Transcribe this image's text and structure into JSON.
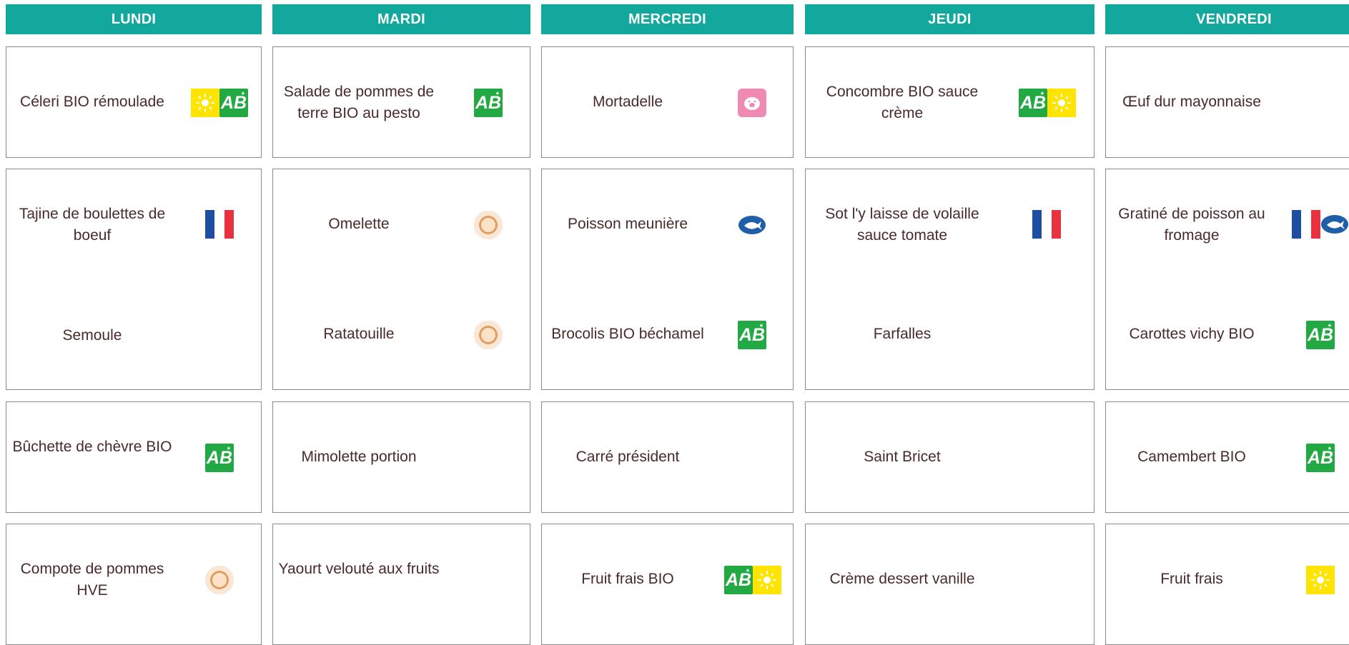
{
  "days": [
    {
      "name": "LUNDI",
      "entree": "Céleri BIO rémoulade",
      "plat": "Tajine de boulettes de boeuf",
      "accomp": "Semoule",
      "fromage": "Bûchette de chèvre BIO",
      "dessert": "Compote de pommes HVE"
    },
    {
      "name": "MARDI",
      "entree": "Salade de pommes de terre BIO au pesto",
      "plat": "Omelette",
      "accomp": "Ratatouille",
      "fromage": "Mimolette portion",
      "dessert": "Yaourt velouté aux fruits"
    },
    {
      "name": "MERCREDI",
      "entree": "Mortadelle",
      "plat": "Poisson meunière",
      "accomp": "Brocolis BIO béchamel",
      "fromage": "Carré président",
      "dessert": "Fruit frais BIO"
    },
    {
      "name": "JEUDI",
      "entree": "Concombre BIO sauce crème",
      "plat": "Sot l'y laisse de volaille sauce tomate",
      "accomp": "Farfalles",
      "fromage": "Saint Bricet",
      "dessert": "Crème dessert vanille"
    },
    {
      "name": "VENDREDI",
      "entree": "Œuf dur mayonnaise",
      "plat": "Gratiné de poisson au fromage",
      "accomp": "Carottes vichy BIO",
      "fromage": "Camembert BIO",
      "dessert": "Fruit frais"
    }
  ],
  "badges": {
    "lundi_entree": [
      "sun-icon",
      "ab-bio-icon"
    ],
    "lundi_plat": [
      "french-flag-icon"
    ],
    "lundi_fromage": [
      "ab-bio-icon"
    ],
    "lundi_dessert": [
      "hve-icon"
    ],
    "mardi_entree": [
      "ab-bio-icon"
    ],
    "mardi_plat": [
      "hve-icon"
    ],
    "mardi_accomp": [
      "hve-icon"
    ],
    "mercredi_entree": [
      "pork-icon"
    ],
    "mercredi_plat": [
      "msc-fish-icon"
    ],
    "mercredi_accomp": [
      "ab-bio-icon"
    ],
    "mercredi_dessert": [
      "ab-bio-icon",
      "sun-icon"
    ],
    "jeudi_entree": [
      "ab-bio-icon",
      "sun-icon"
    ],
    "jeudi_plat": [
      "french-flag-icon"
    ],
    "vendredi_plat": [
      "french-flag-icon",
      "msc-fish-icon"
    ],
    "vendredi_accomp": [
      "ab-bio-icon"
    ],
    "vendredi_fromage": [
      "ab-bio-icon"
    ],
    "vendredi_dessert": [
      "sun-icon"
    ]
  },
  "colors": {
    "header": "#12a89d",
    "header_text": "#ffffff",
    "text": "#4a2a2a",
    "border": "#8a8a8a",
    "ab_green": "#23a943",
    "sun_yellow": "#ffe400",
    "flag_blue": "#1d4ea0",
    "flag_red": "#e8323f",
    "pig_pink": "#ef8ab2",
    "msc_blue": "#1f5ea8"
  }
}
